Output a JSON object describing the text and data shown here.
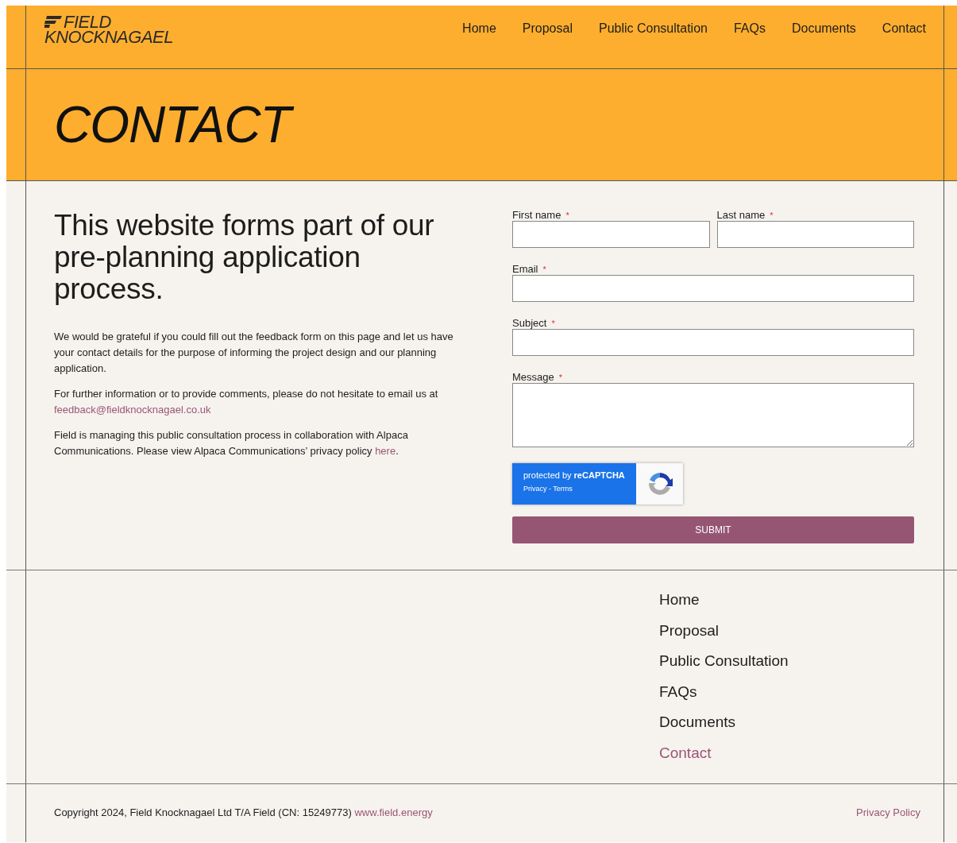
{
  "logo": {
    "line_1": "FIELD",
    "line_2": "KNOCKNAGAEL"
  },
  "nav": [
    {
      "label": "Home",
      "selected": false
    },
    {
      "label": "Proposal",
      "selected": false
    },
    {
      "label": "Public Consultation",
      "selected": false
    },
    {
      "label": "FAQs",
      "selected": false
    },
    {
      "label": "Documents",
      "selected": false
    },
    {
      "label": "Contact",
      "selected": false
    }
  ],
  "page_title": "CONTACT",
  "intro": {
    "heading": "This website forms part of our pre-planning application process.",
    "paragraphs": [
      {
        "text": "We would be grateful if you could fill out the feedback form on this page and let us have your contact details for the purpose of informing the project design and our planning application."
      },
      {
        "text": "For further information or to provide comments, please do not hesitate to email us at ",
        "link": "feedback@fieldknocknagael.co.uk"
      },
      {
        "text": "Field is managing this public consultation process in collaboration with Alpaca Communications. Please view Alpaca Communications’ privacy policy ",
        "link": "here",
        "after": "."
      }
    ]
  },
  "form": {
    "required_mark": "*",
    "rows": [
      [
        {
          "label": "First name",
          "required": true,
          "kind": "text"
        },
        {
          "label": "Last name",
          "required": true,
          "kind": "text"
        }
      ],
      [
        {
          "label": "Email",
          "required": true,
          "kind": "text"
        }
      ],
      [
        {
          "label": "Subject",
          "required": true,
          "kind": "text"
        }
      ],
      [
        {
          "label": "Message",
          "required": true,
          "kind": "textarea"
        }
      ]
    ],
    "recaptcha": {
      "text": "protected by **reCAPTCHA**",
      "privacy": "Privacy",
      "separator": " - ",
      "terms": "Terms"
    },
    "submit": "SUBMIT"
  },
  "footer_nav": [
    {
      "label": "Home",
      "selected": false
    },
    {
      "label": "Proposal",
      "selected": false
    },
    {
      "label": "Public Consultation",
      "selected": false
    },
    {
      "label": "FAQs",
      "selected": false
    },
    {
      "label": "Documents",
      "selected": false
    },
    {
      "label": "Contact",
      "selected": true
    }
  ],
  "bottom": {
    "copyright": "Copyright 2024, Field Knocknagael Ltd T/A Field (CN: 15249773) ",
    "link": "www.field.energy",
    "privacy": "Privacy Policy"
  }
}
